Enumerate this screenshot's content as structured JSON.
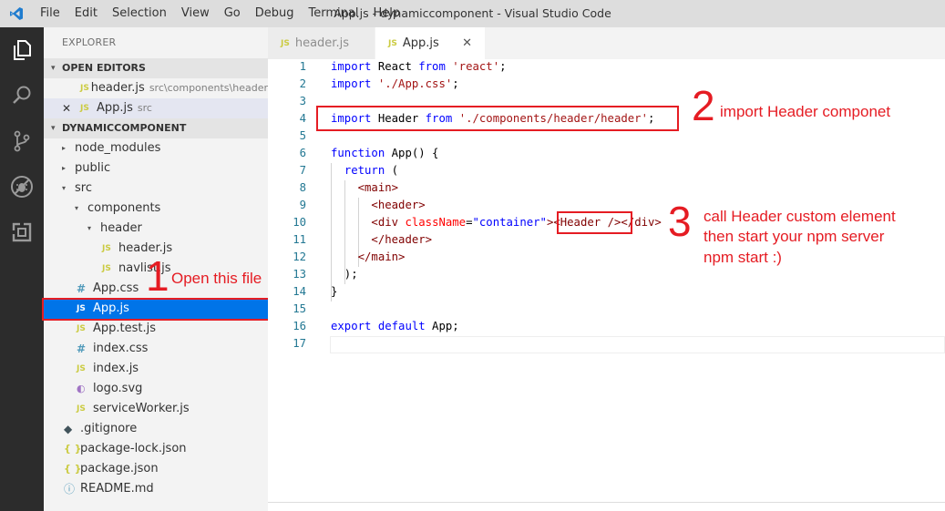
{
  "window": {
    "title": "App.js - dynamiccomponent - Visual Studio Code",
    "menu": [
      "File",
      "Edit",
      "Selection",
      "View",
      "Go",
      "Debug",
      "Terminal",
      "Help"
    ]
  },
  "activity_bar": {
    "icons": [
      "files-icon",
      "search-icon",
      "source-control-icon",
      "debug-icon",
      "extensions-icon"
    ]
  },
  "sidebar": {
    "title": "EXPLORER",
    "open_editors": {
      "header": "OPEN EDITORS",
      "items": [
        {
          "name": "header.js",
          "path": "src\\components\\header"
        },
        {
          "name": "App.js",
          "path": "src",
          "close": "✕"
        }
      ]
    },
    "project": {
      "header": "DYNAMICCOMPONENT",
      "tree": [
        {
          "label": "node_modules",
          "type": "folder",
          "indent": 0
        },
        {
          "label": "public",
          "type": "folder",
          "indent": 0
        },
        {
          "label": "src",
          "type": "folder-open",
          "indent": 0
        },
        {
          "label": "components",
          "type": "folder-open",
          "indent": 1
        },
        {
          "label": "header",
          "type": "folder-open",
          "indent": 2
        },
        {
          "label": "header.js",
          "type": "js",
          "indent": 3
        },
        {
          "label": "navlist.js",
          "type": "js",
          "indent": 3
        },
        {
          "label": "App.css",
          "type": "css",
          "indent": 1
        },
        {
          "label": "App.js",
          "type": "js",
          "indent": 1,
          "selected": true
        },
        {
          "label": "App.test.js",
          "type": "js",
          "indent": 1
        },
        {
          "label": "index.css",
          "type": "css",
          "indent": 1
        },
        {
          "label": "index.js",
          "type": "js",
          "indent": 1
        },
        {
          "label": "logo.svg",
          "type": "svg",
          "indent": 1
        },
        {
          "label": "serviceWorker.js",
          "type": "js",
          "indent": 1
        },
        {
          "label": ".gitignore",
          "type": "git",
          "indent": 0
        },
        {
          "label": "package-lock.json",
          "type": "json",
          "indent": 0
        },
        {
          "label": "package.json",
          "type": "json",
          "indent": 0
        },
        {
          "label": "README.md",
          "type": "info",
          "indent": 0
        }
      ]
    }
  },
  "tabs": [
    {
      "label": "header.js",
      "active": false
    },
    {
      "label": "App.js",
      "active": true,
      "close": "✕"
    }
  ],
  "icon_badges": {
    "js": "JS",
    "css": "#",
    "json": "{ }",
    "info": "ⓘ",
    "git": "◆",
    "svg": "◐"
  },
  "editor": {
    "line_numbers": [
      "1",
      "2",
      "3",
      "4",
      "5",
      "6",
      "7",
      "8",
      "9",
      "10",
      "11",
      "12",
      "13",
      "14",
      "15",
      "16",
      "17"
    ],
    "lines": [
      [
        {
          "t": "import",
          "c": "kw"
        },
        {
          "t": " React "
        },
        {
          "t": "from",
          "c": "kw"
        },
        {
          "t": " "
        },
        {
          "t": "'react'",
          "c": "str"
        },
        {
          "t": ";"
        }
      ],
      [
        {
          "t": "import",
          "c": "kw"
        },
        {
          "t": " "
        },
        {
          "t": "'./App.css'",
          "c": "str"
        },
        {
          "t": ";"
        }
      ],
      [],
      [
        {
          "t": "import",
          "c": "kw"
        },
        {
          "t": " Header "
        },
        {
          "t": "from",
          "c": "kw"
        },
        {
          "t": " "
        },
        {
          "t": "'./components/header/header'",
          "c": "str"
        },
        {
          "t": ";"
        }
      ],
      [],
      [
        {
          "t": "function",
          "c": "kw"
        },
        {
          "t": " App() {"
        }
      ],
      [
        {
          "t": "  "
        },
        {
          "t": "return",
          "c": "kw"
        },
        {
          "t": " ("
        }
      ],
      [
        {
          "t": "    "
        },
        {
          "t": "<main>",
          "c": "tag"
        }
      ],
      [
        {
          "t": "      "
        },
        {
          "t": "<header>",
          "c": "tag"
        }
      ],
      [
        {
          "t": "      "
        },
        {
          "t": "<div",
          "c": "tag"
        },
        {
          "t": " "
        },
        {
          "t": "className",
          "c": "attr"
        },
        {
          "t": "="
        },
        {
          "t": "\"container\"",
          "c": "kw"
        },
        {
          "t": ">",
          "c": "tag"
        },
        {
          "t": "<Header />",
          "c": "tag"
        },
        {
          "t": "</div>",
          "c": "tag"
        }
      ],
      [
        {
          "t": "      "
        },
        {
          "t": "</header>",
          "c": "tag"
        }
      ],
      [
        {
          "t": "    "
        },
        {
          "t": "</main>",
          "c": "tag"
        }
      ],
      [
        {
          "t": "  );"
        }
      ],
      [
        {
          "t": "}"
        }
      ],
      [],
      [
        {
          "t": "export",
          "c": "kw"
        },
        {
          "t": " "
        },
        {
          "t": "default",
          "c": "kw"
        },
        {
          "t": " App;"
        }
      ],
      []
    ]
  },
  "annotations": [
    {
      "number": "1",
      "text": "Open this file"
    },
    {
      "number": "2",
      "text": "import Header componet"
    },
    {
      "number": "3",
      "lines": [
        "call Header custom element",
        "then start your npm server",
        "npm start :)"
      ]
    }
  ],
  "colors": {
    "annotation": "#e51c23",
    "selection": "#0074e8",
    "activity_bar": "#2c2c2c"
  }
}
